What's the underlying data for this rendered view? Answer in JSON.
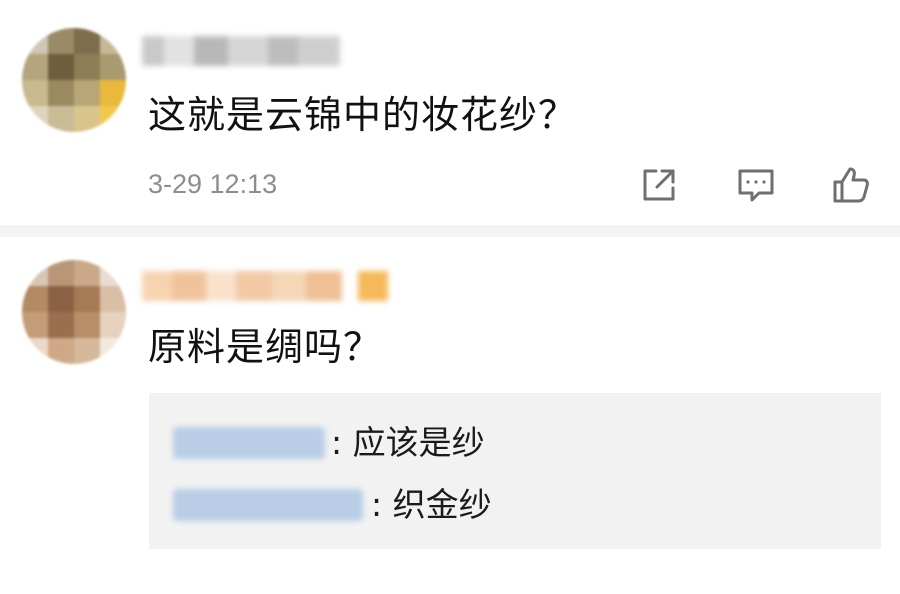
{
  "comments": [
    {
      "text": "这就是云锦中的妆花纱？",
      "timestamp": "3-29 12:13",
      "actions": [
        "share-icon",
        "comment-icon",
        "like-icon"
      ]
    },
    {
      "text": "原料是绸吗？",
      "replies": [
        {
          "text": ": 应该是纱"
        },
        {
          "text": ": 织金纱"
        }
      ]
    }
  ],
  "colors": {
    "text": "#111111",
    "timestamp": "#8d8d8d",
    "icon": "#6f6f6f",
    "reply_bg": "#f2f2f2",
    "separator": "#f4f4f4"
  }
}
